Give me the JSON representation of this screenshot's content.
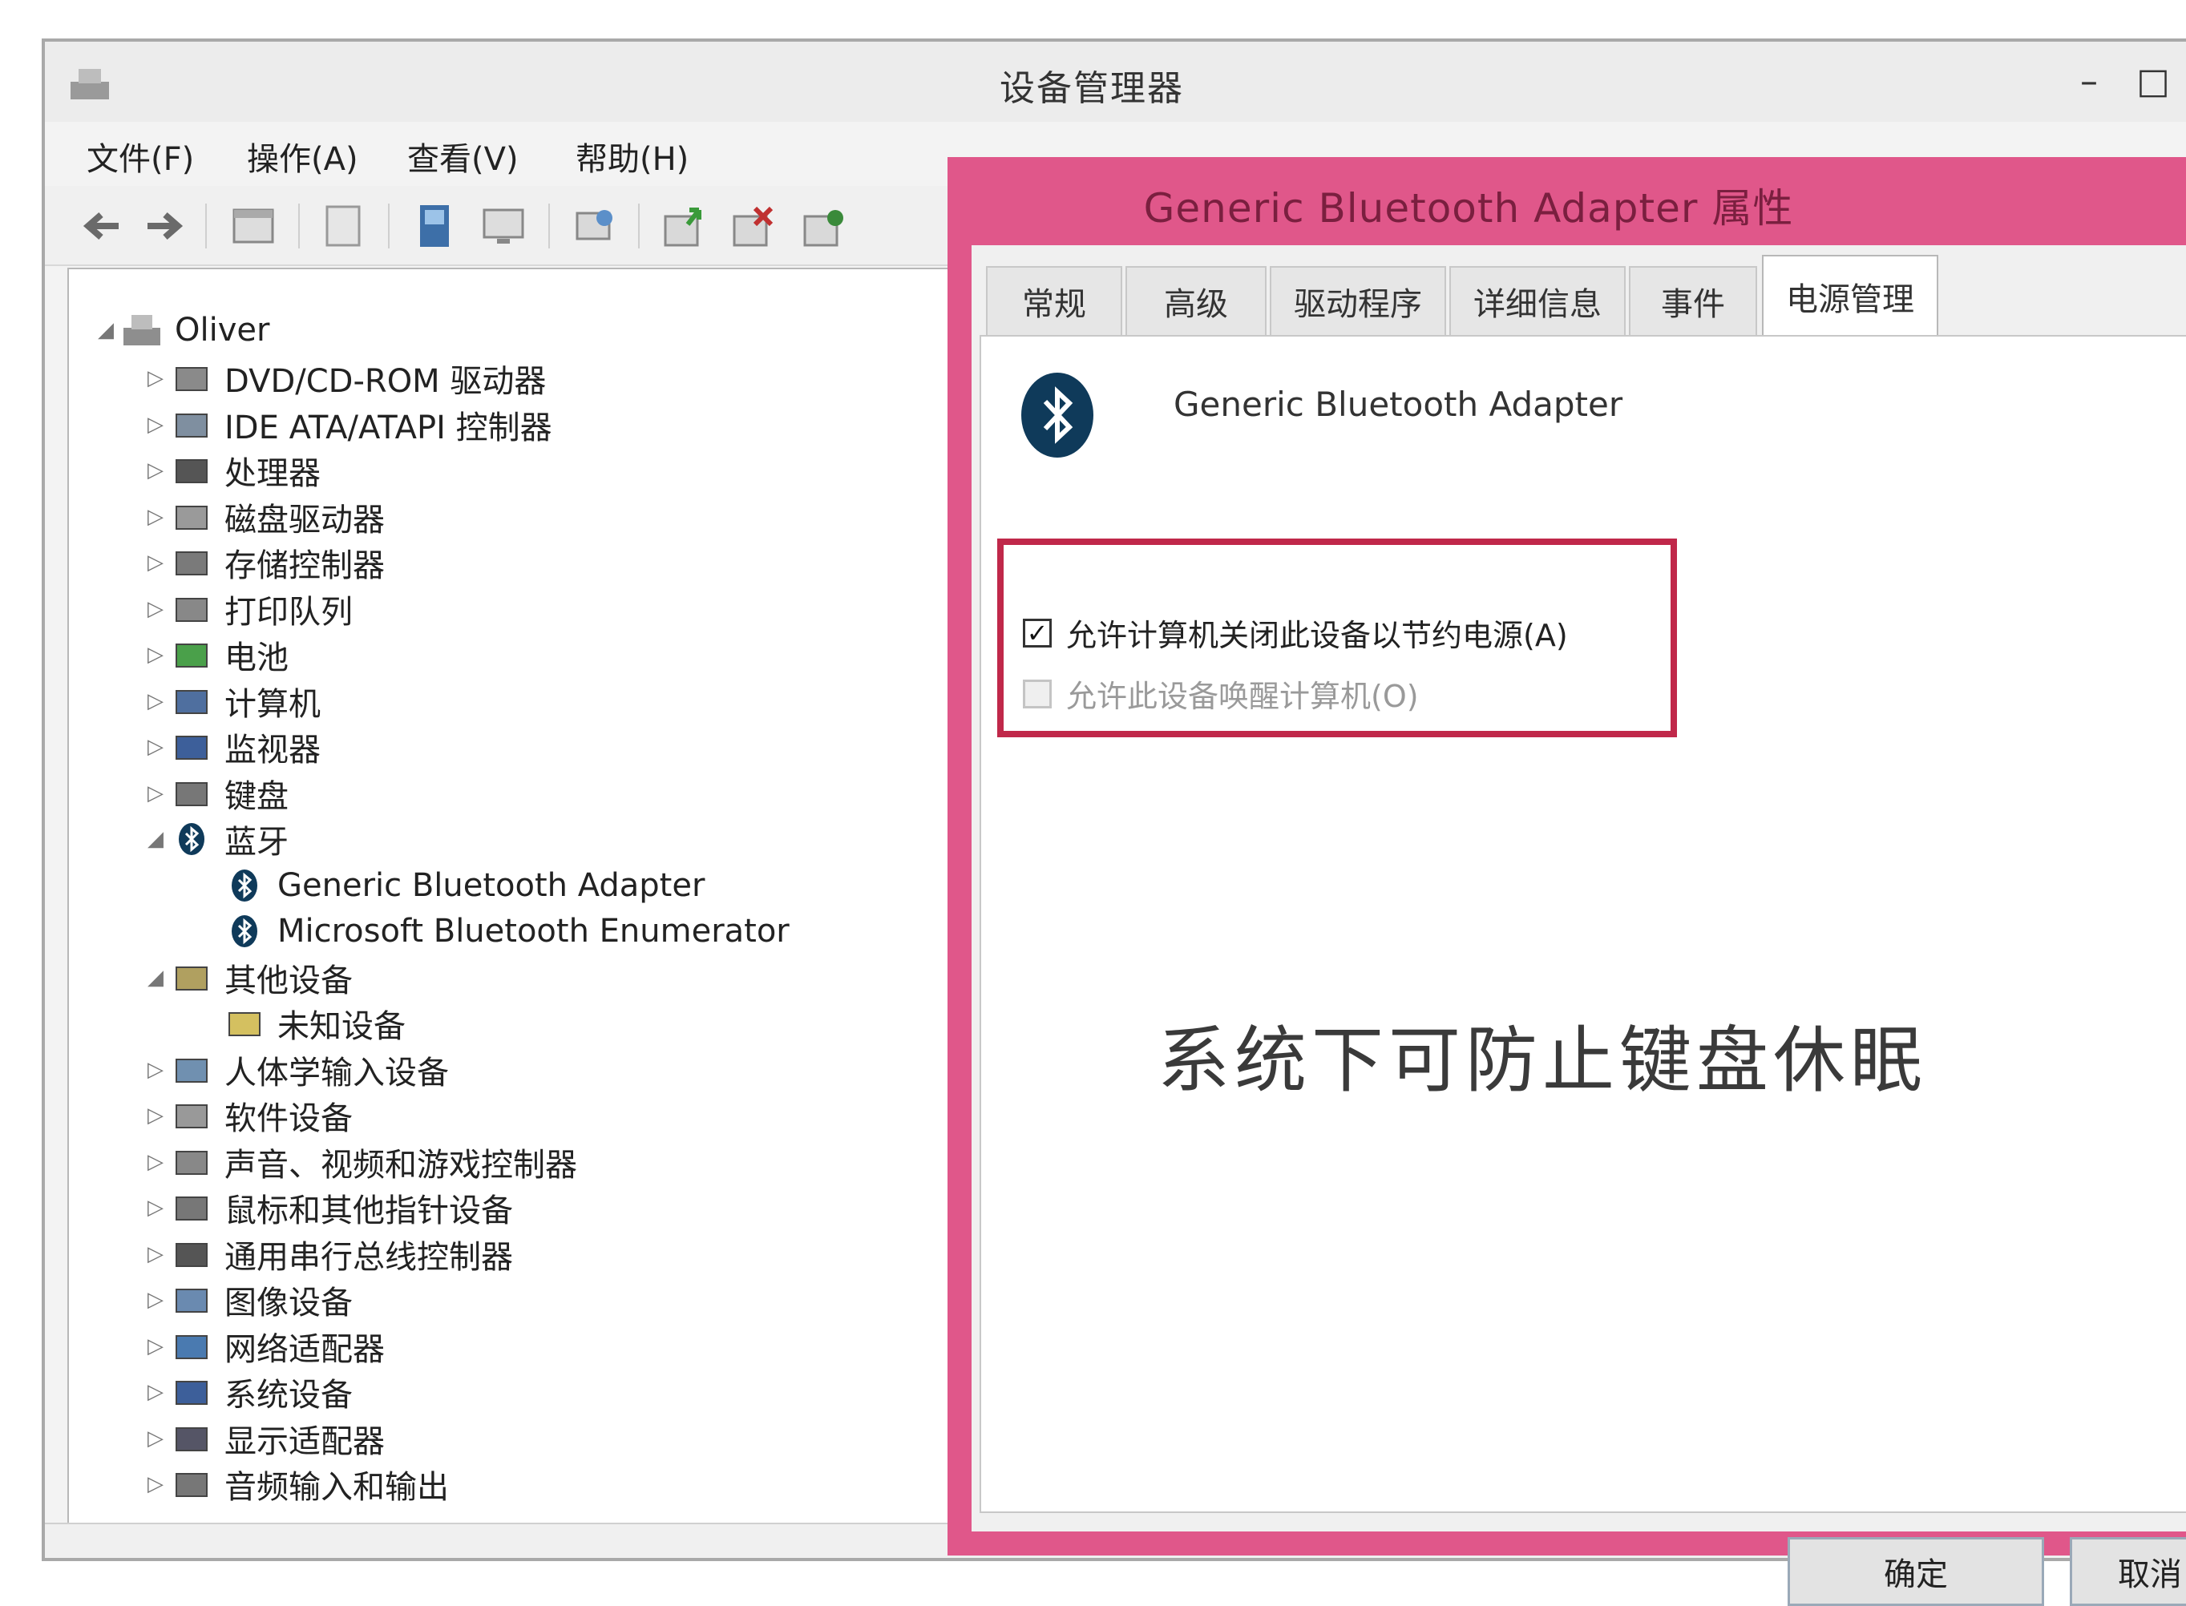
{
  "window": {
    "title": "设备管理器",
    "minimize_glyph": "–",
    "maximize_glyph": "□"
  },
  "menubar": [
    "文件(F)",
    "操作(A)",
    "查看(V)",
    "帮助(H)"
  ],
  "toolbar": [
    "back-icon",
    "forward-icon",
    "properties-icon",
    "view-icon",
    "help-icon",
    "monitor-icon",
    "scan-icon",
    "update-driver-icon",
    "disable-icon",
    "uninstall-icon"
  ],
  "tree": {
    "root": "Oliver",
    "categories": [
      {
        "label": "DVD/CD-ROM 驱动器",
        "expanded": false
      },
      {
        "label": "IDE ATA/ATAPI 控制器",
        "expanded": false
      },
      {
        "label": "处理器",
        "expanded": false
      },
      {
        "label": "磁盘驱动器",
        "expanded": false
      },
      {
        "label": "存储控制器",
        "expanded": false
      },
      {
        "label": "打印队列",
        "expanded": false
      },
      {
        "label": "电池",
        "expanded": false
      },
      {
        "label": "计算机",
        "expanded": false
      },
      {
        "label": "监视器",
        "expanded": false
      },
      {
        "label": "键盘",
        "expanded": false
      },
      {
        "label": "蓝牙",
        "expanded": true,
        "children": [
          "Generic Bluetooth Adapter",
          "Microsoft Bluetooth Enumerator"
        ]
      },
      {
        "label": "其他设备",
        "expanded": true,
        "children": [
          "未知设备"
        ]
      },
      {
        "label": "人体学输入设备",
        "expanded": false
      },
      {
        "label": "软件设备",
        "expanded": false
      },
      {
        "label": "声音、视频和游戏控制器",
        "expanded": false
      },
      {
        "label": "鼠标和其他指针设备",
        "expanded": false
      },
      {
        "label": "通用串行总线控制器",
        "expanded": false
      },
      {
        "label": "图像设备",
        "expanded": false
      },
      {
        "label": "网络适配器",
        "expanded": false
      },
      {
        "label": "系统设备",
        "expanded": false
      },
      {
        "label": "显示适配器",
        "expanded": false
      },
      {
        "label": "音频输入和输出",
        "expanded": false
      }
    ]
  },
  "dialog": {
    "title": "Generic Bluetooth Adapter 属性",
    "tabs": [
      "常规",
      "高级",
      "驱动程序",
      "详细信息",
      "事件",
      "电源管理"
    ],
    "active_tab": "电源管理",
    "device_name": "Generic Bluetooth Adapter",
    "checkbox_1": {
      "label": "允许计算机关闭此设备以节约电源(A)",
      "checked": true
    },
    "checkbox_2": {
      "label": "允许此设备唤醒计算机(O)",
      "checked": false,
      "enabled": false
    },
    "caption": "系统下可防止键盘休眠",
    "ok_label": "确定",
    "cancel_label": "取消",
    "highlight_color": "#c0284a",
    "frame_color": "#e0578a"
  }
}
